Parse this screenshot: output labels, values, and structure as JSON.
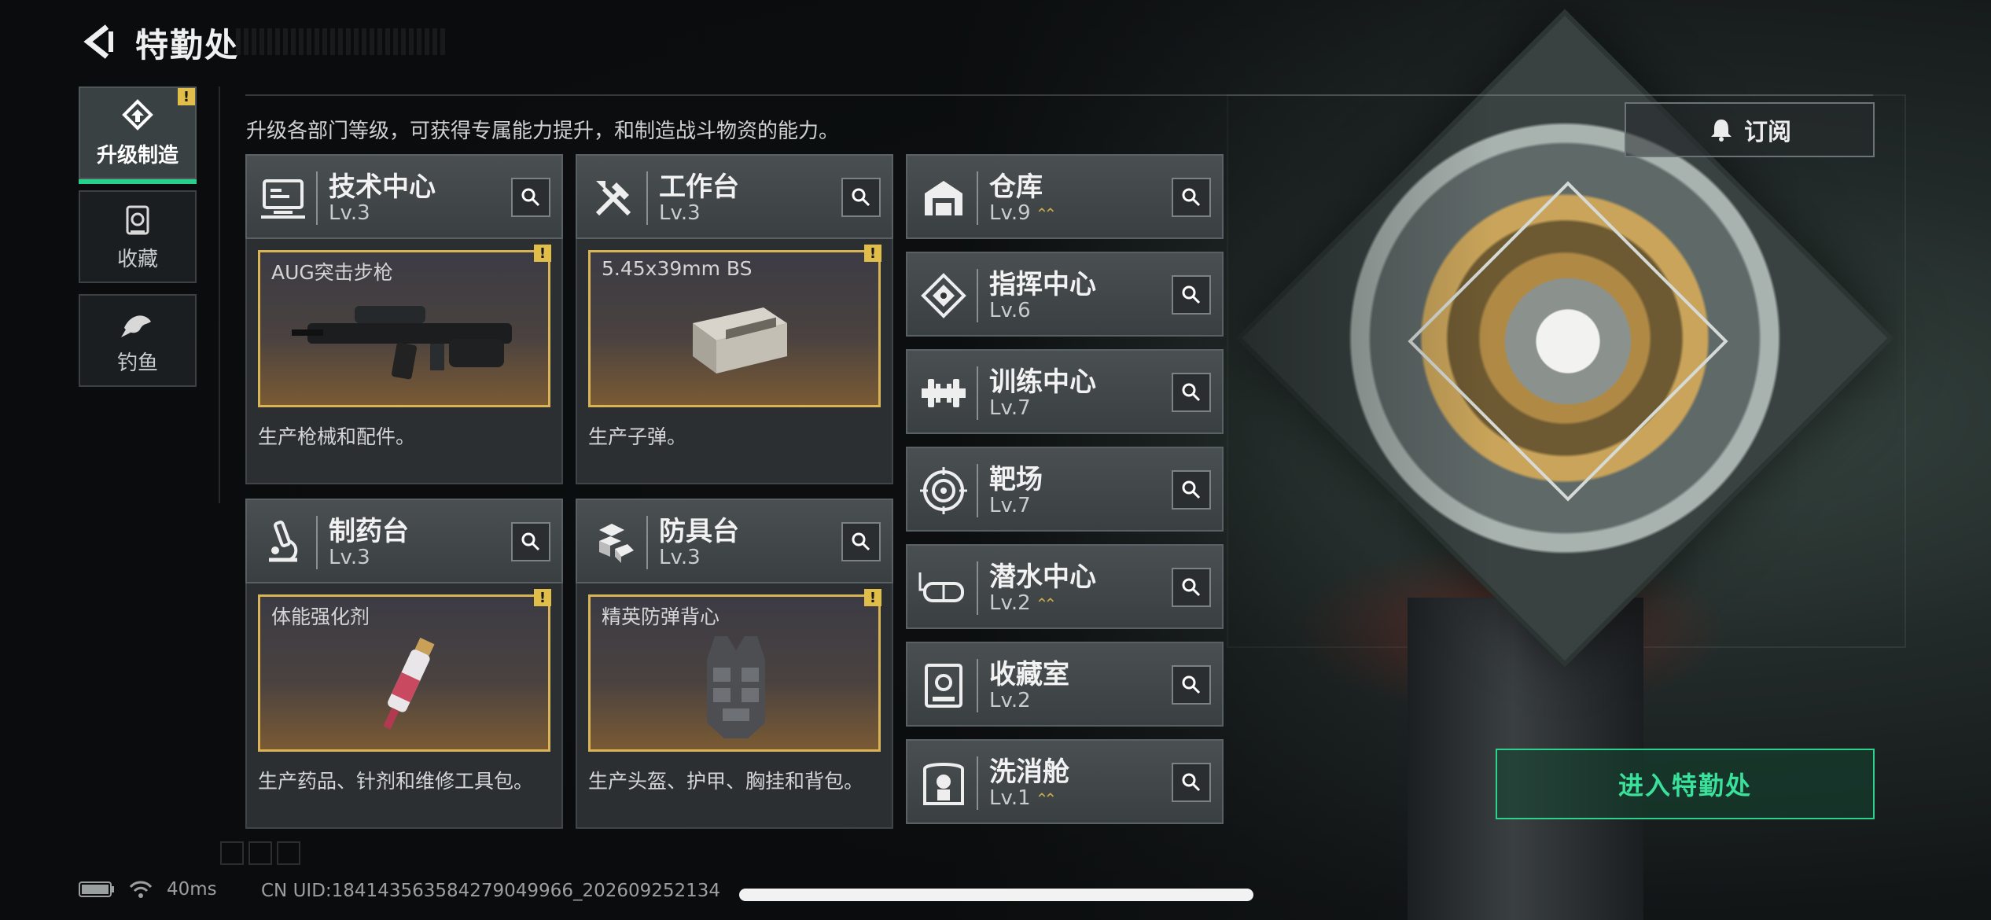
{
  "header": {
    "title": "特勤处"
  },
  "nav": [
    {
      "key": "upgrade",
      "label": "升级制造",
      "icon": "upgrade-icon",
      "warn": "!"
    },
    {
      "key": "collection",
      "label": "收藏",
      "icon": "collection-icon"
    },
    {
      "key": "fishing",
      "label": "钓鱼",
      "icon": "fish-icon"
    }
  ],
  "main": {
    "subtitle": "升级各部门等级，可获得专属能力提升，和制造战斗物资的能力。",
    "cards": [
      {
        "name": "技术中心",
        "level": "Lv.3",
        "icon": "tech-center-icon",
        "item": "AUG突击步枪",
        "item_icon": "rifle-icon",
        "warn": "!",
        "desc": "生产枪械和配件。"
      },
      {
        "name": "工作台",
        "level": "Lv.3",
        "icon": "workbench-icon",
        "item": "5.45x39mm BS",
        "item_icon": "ammo-box-icon",
        "warn": "!",
        "desc": "生产子弹。"
      },
      {
        "name": "制药台",
        "level": "Lv.3",
        "icon": "pharmacy-icon",
        "item": "体能强化剂",
        "item_icon": "syringe-icon",
        "warn": "!",
        "desc": "生产药品、针剂和维修工具包。"
      },
      {
        "name": "防具台",
        "level": "Lv.3",
        "icon": "armor-bench-icon",
        "item": "精英防弹背心",
        "item_icon": "vest-icon",
        "warn": "!",
        "desc": "生产头盔、护甲、胸挂和背包。"
      }
    ],
    "departments": [
      {
        "name": "仓库",
        "level": "Lv.9",
        "icon": "warehouse-icon",
        "upgradable": true
      },
      {
        "name": "指挥中心",
        "level": "Lv.6",
        "icon": "command-center-icon",
        "upgradable": false
      },
      {
        "name": "训练中心",
        "level": "Lv.7",
        "icon": "training-center-icon",
        "upgradable": false
      },
      {
        "name": "靶场",
        "level": "Lv.7",
        "icon": "shooting-range-icon",
        "upgradable": false
      },
      {
        "name": "潜水中心",
        "level": "Lv.2",
        "icon": "diving-center-icon",
        "upgradable": true
      },
      {
        "name": "收藏室",
        "level": "Lv.2",
        "icon": "collection-room-icon",
        "upgradable": false
      },
      {
        "name": "洗消舱",
        "level": "Lv.1",
        "icon": "decon-cabin-icon",
        "upgradable": true
      }
    ]
  },
  "buttons": {
    "subscribe": "订阅",
    "enter": "进入特勤处"
  },
  "status": {
    "ping": "40ms",
    "uid": "CN UID:18414356358427904996​6_202609252134"
  },
  "colors": {
    "accent": "#27d08b",
    "warning": "#e1bd4a",
    "frame": "#d9b457"
  }
}
